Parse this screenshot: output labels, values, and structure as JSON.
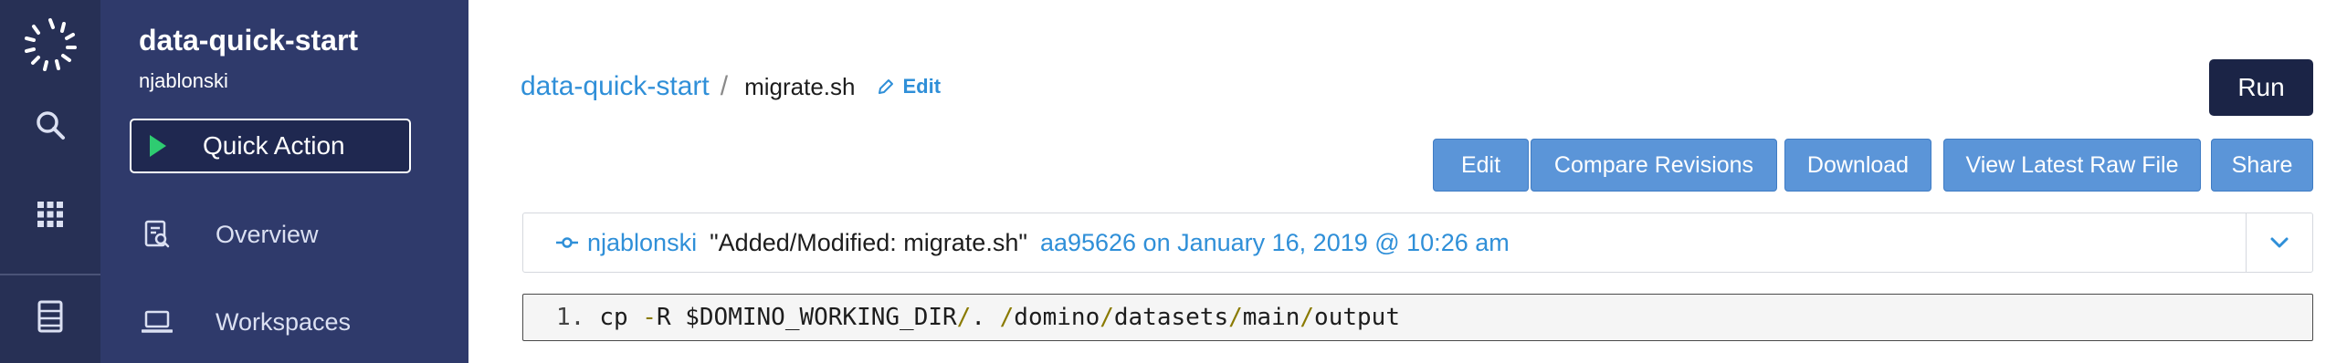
{
  "project": {
    "name": "data-quick-start",
    "owner": "njablonski"
  },
  "sidebar": {
    "quick_action": "Quick Action",
    "items": [
      {
        "label": "Overview"
      },
      {
        "label": "Workspaces"
      }
    ]
  },
  "rail": {
    "icons": [
      "domino-logo-icon",
      "search-icon",
      "apps-grid-icon",
      "datasets-icon"
    ]
  },
  "breadcrumb": {
    "project": "data-quick-start",
    "separator": "/",
    "file": "migrate.sh",
    "edit_label": "Edit"
  },
  "toolbar": {
    "run_label": "Run",
    "buttons": [
      "Edit",
      "Compare Revisions",
      "Download",
      "View Latest Raw File",
      "Share"
    ]
  },
  "commit": {
    "author": "njablonski",
    "message": "\"Added/Modified: migrate.sh\"",
    "sha_date": "aa95626 on January 16, 2019 @ 10:26 am"
  },
  "code": {
    "line_number": "1.",
    "parts": [
      "cp ",
      "-",
      "R $DOMINO_WORKING_DIR",
      "/",
      ". ",
      "/",
      "domino",
      "/",
      "datasets",
      "/",
      "main",
      "/",
      "output"
    ]
  },
  "colors": {
    "accent": "#2f8fd8",
    "button": "#5b95d8",
    "rail": "#273055",
    "sidebar": "#2f3a6b",
    "run": "#1b2446"
  }
}
